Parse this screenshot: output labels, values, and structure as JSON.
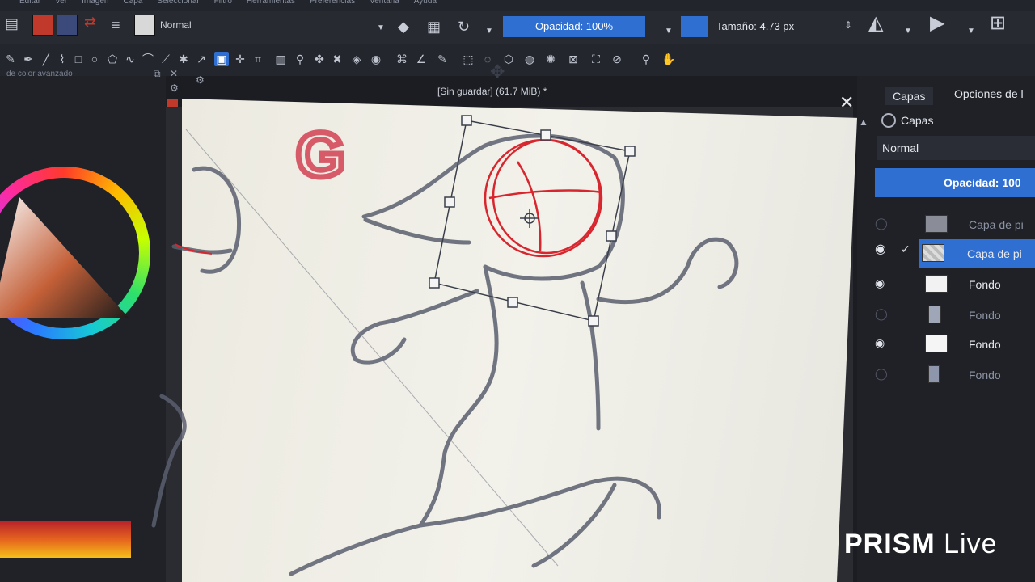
{
  "menu": [
    "Editar",
    "Ver",
    "Imagen",
    "Capa",
    "Seleccionar",
    "Filtro",
    "Herramientas",
    "Preferencias",
    "Ventana",
    "Ayuda"
  ],
  "tool_options": {
    "blend_mode": "Normal",
    "opacity_label": "Opacidad: 100%",
    "size_label": "Tamaño: 4.73 px",
    "fg_color": "#c0392b",
    "bg_color": "#3b4a7a",
    "accent": "#2f6fd1"
  },
  "left_docker": {
    "title": "de color avanzado"
  },
  "document": {
    "title": "[Sin guardar]  (61.7 MiB) *"
  },
  "right_docker": {
    "tabs": [
      "Capas",
      "Opciones de l"
    ],
    "header": "Capas",
    "blend_mode": "Normal",
    "opacity_label": "Opacidad:  100",
    "layers": [
      {
        "name": "Capa de pi",
        "visible": false,
        "checked": false,
        "dim": true
      },
      {
        "name": "Capa de pi",
        "visible": true,
        "checked": true,
        "dim": false
      },
      {
        "name": "Fondo",
        "visible": true,
        "checked": false,
        "dim": false
      },
      {
        "name": "Fondo",
        "visible": false,
        "checked": false,
        "dim": true
      },
      {
        "name": "Fondo",
        "visible": true,
        "checked": false,
        "dim": false
      },
      {
        "name": "Fondo",
        "visible": false,
        "checked": false,
        "dim": true
      }
    ]
  },
  "watermark": {
    "brand": "PRISM",
    "suffix": "Live"
  }
}
